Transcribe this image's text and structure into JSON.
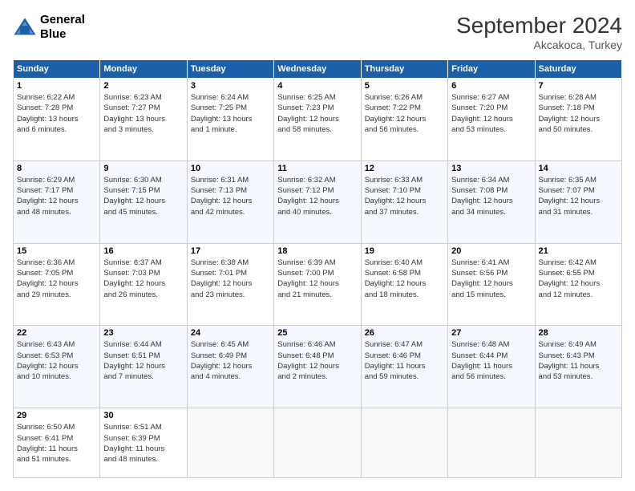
{
  "header": {
    "logo_line1": "General",
    "logo_line2": "Blue",
    "month_title": "September 2024",
    "location": "Akcakoca, Turkey"
  },
  "weekdays": [
    "Sunday",
    "Monday",
    "Tuesday",
    "Wednesday",
    "Thursday",
    "Friday",
    "Saturday"
  ],
  "weeks": [
    [
      {
        "day": "1",
        "info": "Sunrise: 6:22 AM\nSunset: 7:28 PM\nDaylight: 13 hours\nand 6 minutes."
      },
      {
        "day": "2",
        "info": "Sunrise: 6:23 AM\nSunset: 7:27 PM\nDaylight: 13 hours\nand 3 minutes."
      },
      {
        "day": "3",
        "info": "Sunrise: 6:24 AM\nSunset: 7:25 PM\nDaylight: 13 hours\nand 1 minute."
      },
      {
        "day": "4",
        "info": "Sunrise: 6:25 AM\nSunset: 7:23 PM\nDaylight: 12 hours\nand 58 minutes."
      },
      {
        "day": "5",
        "info": "Sunrise: 6:26 AM\nSunset: 7:22 PM\nDaylight: 12 hours\nand 56 minutes."
      },
      {
        "day": "6",
        "info": "Sunrise: 6:27 AM\nSunset: 7:20 PM\nDaylight: 12 hours\nand 53 minutes."
      },
      {
        "day": "7",
        "info": "Sunrise: 6:28 AM\nSunset: 7:18 PM\nDaylight: 12 hours\nand 50 minutes."
      }
    ],
    [
      {
        "day": "8",
        "info": "Sunrise: 6:29 AM\nSunset: 7:17 PM\nDaylight: 12 hours\nand 48 minutes."
      },
      {
        "day": "9",
        "info": "Sunrise: 6:30 AM\nSunset: 7:15 PM\nDaylight: 12 hours\nand 45 minutes."
      },
      {
        "day": "10",
        "info": "Sunrise: 6:31 AM\nSunset: 7:13 PM\nDaylight: 12 hours\nand 42 minutes."
      },
      {
        "day": "11",
        "info": "Sunrise: 6:32 AM\nSunset: 7:12 PM\nDaylight: 12 hours\nand 40 minutes."
      },
      {
        "day": "12",
        "info": "Sunrise: 6:33 AM\nSunset: 7:10 PM\nDaylight: 12 hours\nand 37 minutes."
      },
      {
        "day": "13",
        "info": "Sunrise: 6:34 AM\nSunset: 7:08 PM\nDaylight: 12 hours\nand 34 minutes."
      },
      {
        "day": "14",
        "info": "Sunrise: 6:35 AM\nSunset: 7:07 PM\nDaylight: 12 hours\nand 31 minutes."
      }
    ],
    [
      {
        "day": "15",
        "info": "Sunrise: 6:36 AM\nSunset: 7:05 PM\nDaylight: 12 hours\nand 29 minutes."
      },
      {
        "day": "16",
        "info": "Sunrise: 6:37 AM\nSunset: 7:03 PM\nDaylight: 12 hours\nand 26 minutes."
      },
      {
        "day": "17",
        "info": "Sunrise: 6:38 AM\nSunset: 7:01 PM\nDaylight: 12 hours\nand 23 minutes."
      },
      {
        "day": "18",
        "info": "Sunrise: 6:39 AM\nSunset: 7:00 PM\nDaylight: 12 hours\nand 21 minutes."
      },
      {
        "day": "19",
        "info": "Sunrise: 6:40 AM\nSunset: 6:58 PM\nDaylight: 12 hours\nand 18 minutes."
      },
      {
        "day": "20",
        "info": "Sunrise: 6:41 AM\nSunset: 6:56 PM\nDaylight: 12 hours\nand 15 minutes."
      },
      {
        "day": "21",
        "info": "Sunrise: 6:42 AM\nSunset: 6:55 PM\nDaylight: 12 hours\nand 12 minutes."
      }
    ],
    [
      {
        "day": "22",
        "info": "Sunrise: 6:43 AM\nSunset: 6:53 PM\nDaylight: 12 hours\nand 10 minutes."
      },
      {
        "day": "23",
        "info": "Sunrise: 6:44 AM\nSunset: 6:51 PM\nDaylight: 12 hours\nand 7 minutes."
      },
      {
        "day": "24",
        "info": "Sunrise: 6:45 AM\nSunset: 6:49 PM\nDaylight: 12 hours\nand 4 minutes."
      },
      {
        "day": "25",
        "info": "Sunrise: 6:46 AM\nSunset: 6:48 PM\nDaylight: 12 hours\nand 2 minutes."
      },
      {
        "day": "26",
        "info": "Sunrise: 6:47 AM\nSunset: 6:46 PM\nDaylight: 11 hours\nand 59 minutes."
      },
      {
        "day": "27",
        "info": "Sunrise: 6:48 AM\nSunset: 6:44 PM\nDaylight: 11 hours\nand 56 minutes."
      },
      {
        "day": "28",
        "info": "Sunrise: 6:49 AM\nSunset: 6:43 PM\nDaylight: 11 hours\nand 53 minutes."
      }
    ],
    [
      {
        "day": "29",
        "info": "Sunrise: 6:50 AM\nSunset: 6:41 PM\nDaylight: 11 hours\nand 51 minutes."
      },
      {
        "day": "30",
        "info": "Sunrise: 6:51 AM\nSunset: 6:39 PM\nDaylight: 11 hours\nand 48 minutes."
      },
      {
        "day": "",
        "info": ""
      },
      {
        "day": "",
        "info": ""
      },
      {
        "day": "",
        "info": ""
      },
      {
        "day": "",
        "info": ""
      },
      {
        "day": "",
        "info": ""
      }
    ]
  ]
}
